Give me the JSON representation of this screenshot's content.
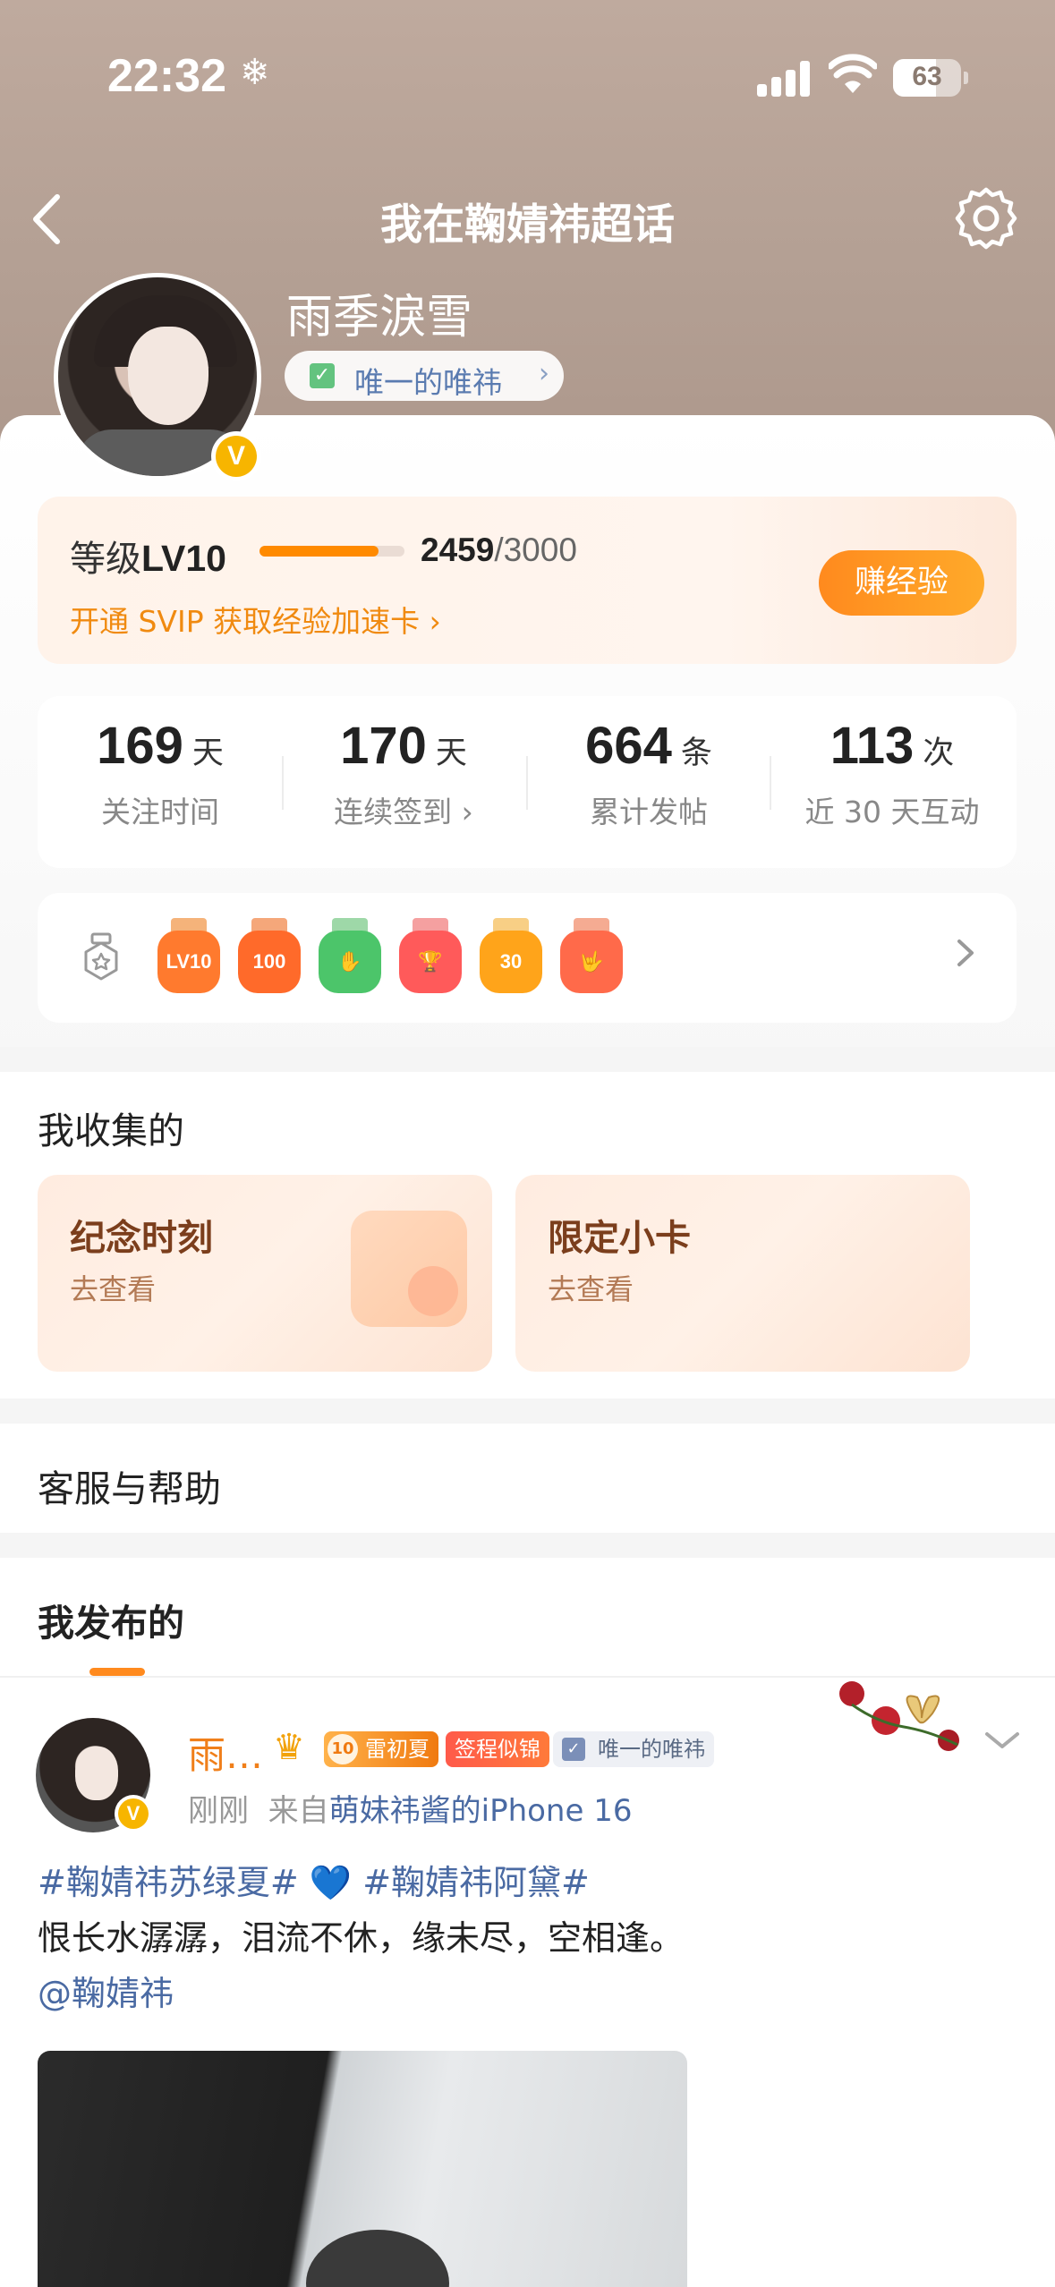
{
  "status_bar": {
    "time": "22:32",
    "battery": "63",
    "battery_level": 0.63
  },
  "nav": {
    "title": "我在鞠婧祎超话"
  },
  "profile": {
    "username": "雨季淚雪",
    "fan_tag": "唯一的唯祎",
    "verified_mark": "V"
  },
  "level": {
    "label_prefix": "等级",
    "level": "LV10",
    "exp_current": "2459",
    "exp_max": "/3000",
    "progress": 0.8197,
    "svip_link": "开通 SVIP 获取经验加速卡 ›",
    "earn_button": "赚经验"
  },
  "stats": [
    {
      "value": "169",
      "unit": "天",
      "label": "关注时间"
    },
    {
      "value": "170",
      "unit": "天",
      "label": "连续签到 ›"
    },
    {
      "value": "664",
      "unit": "条",
      "label": "累计发帖"
    },
    {
      "value": "113",
      "unit": "次",
      "label": "近 30 天互动"
    }
  ],
  "medals": [
    {
      "text": "LV10",
      "color": "#ff7a2e",
      "icon": "level-medal"
    },
    {
      "text": "100",
      "color": "#ff6a2a",
      "icon": "100-days-medal"
    },
    {
      "text": "✋",
      "color": "#4cc56a",
      "icon": "hand-medal"
    },
    {
      "text": "🏆",
      "color": "#ff5a5a",
      "icon": "trophy-medal"
    },
    {
      "text": "30",
      "color": "#ffa41a",
      "icon": "30-days-medal"
    },
    {
      "text": "🤟",
      "color": "#ff6a4a",
      "icon": "gesture-medal"
    }
  ],
  "collection": {
    "title": "我收集的",
    "cards": [
      {
        "title": "纪念时刻",
        "subtitle": "去查看"
      },
      {
        "title": "限定小卡",
        "subtitle": "去查看"
      }
    ]
  },
  "help": {
    "title": "客服与帮助"
  },
  "posts_tab": {
    "title": "我发布的"
  },
  "post": {
    "author": "雨…",
    "level_badge_num": "10",
    "level_badge": "雷初夏",
    "sign_badge": "签程似锦",
    "fan_badge": "唯一的唯祎",
    "meta_time": "刚刚",
    "meta_from": "来自",
    "meta_source": "萌妹祎酱的iPhone 16",
    "tag1": "#鞠婧祎苏绿夏#",
    "heart": "💙",
    "tag2": "#鞠婧祎阿黛#",
    "line2": "恨长水潺潺，泪流不休，缘未尽，空相逢。",
    "mention": "@鞠婧祎"
  },
  "colors": {
    "accent": "#ff8a1e",
    "link": "#4a6aa3",
    "verified": "#f7b500"
  }
}
